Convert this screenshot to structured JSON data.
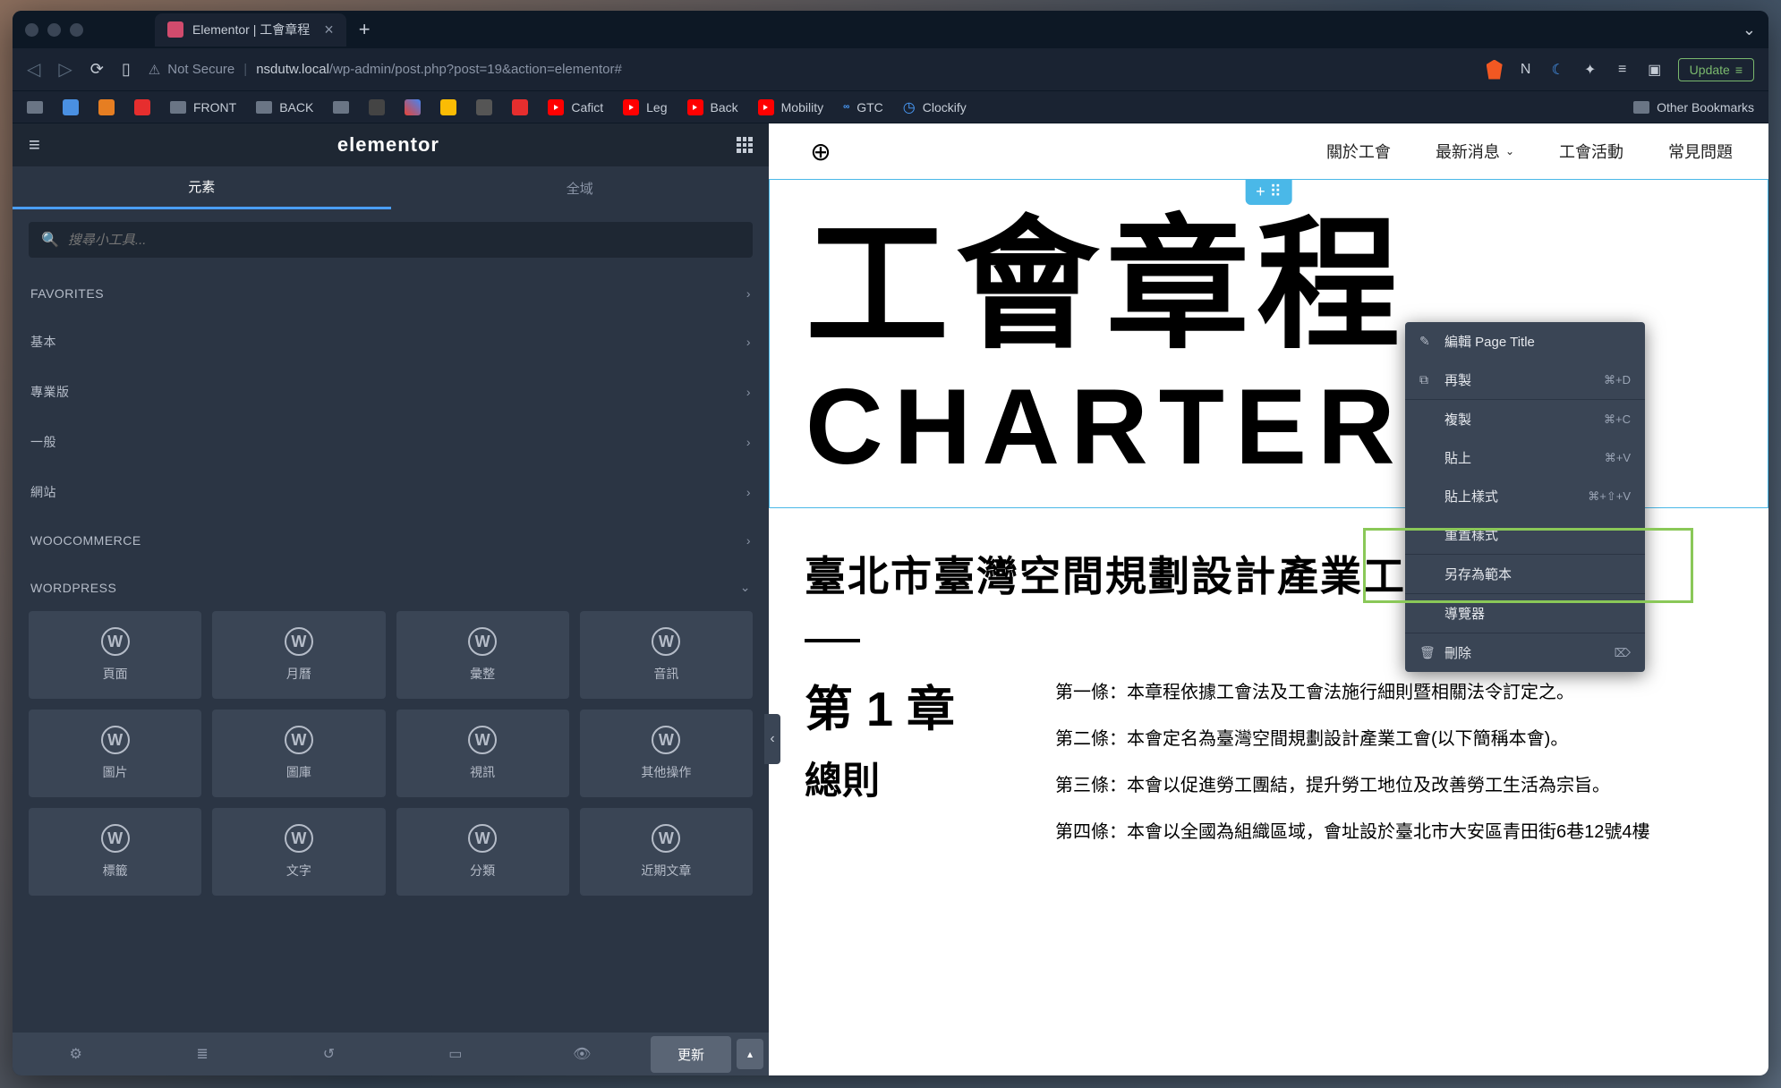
{
  "browser": {
    "tab_title": "Elementor | 工會章程",
    "not_secure": "Not Secure",
    "url_domain": "nsdutw.local",
    "url_path": "/wp-admin/post.php?post=19&action=elementor#",
    "update_button": "Update"
  },
  "bookmarks": {
    "front": "FRONT",
    "back": "BACK",
    "cafict": "Cafict",
    "leg": "Leg",
    "back2": "Back",
    "mobility": "Mobility",
    "gtc": "GTC",
    "clockify": "Clockify",
    "other": "Other Bookmarks"
  },
  "elementor": {
    "logo": "elementor",
    "tab_elements": "元素",
    "tab_global": "全域",
    "search_placeholder": "搜尋小工具...",
    "update_btn": "更新",
    "categories": {
      "favorites": "FAVORITES",
      "basic": "基本",
      "pro": "專業版",
      "general": "一般",
      "site": "網站",
      "woocommerce": "WOOCOMMERCE",
      "wordpress": "WORDPRESS"
    },
    "widgets": [
      "頁面",
      "月曆",
      "彙整",
      "音訊",
      "圖片",
      "圖庫",
      "視訊",
      "其他操作",
      "標籤",
      "文字",
      "分類",
      "近期文章"
    ]
  },
  "page": {
    "nav": {
      "about": "關於工會",
      "news": "最新消息",
      "events": "工會活動",
      "faq": "常見問題"
    },
    "title_zh": "工會章程",
    "title_en": "CHARTER",
    "org_title": "臺北市臺灣空間規劃設計產業工會",
    "chapter_num": "第 1 章",
    "chapter_name": "總則",
    "article1": "第一條：本章程依據工會法及工會法施行細則暨相關法令訂定之。",
    "article2": "第二條：本會定名為臺灣空間規劃設計產業工會(以下簡稱本會)。",
    "article3": "第三條：本會以促進勞工團結，提升勞工地位及改善勞工生活為宗旨。",
    "article4": "第四條：本會以全國為組織區域，會址設於臺北市大安區青田街6巷12號4樓"
  },
  "context_menu": {
    "edit": "編輯 Page Title",
    "duplicate": "再製",
    "duplicate_key": "⌘+D",
    "copy": "複製",
    "copy_key": "⌘+C",
    "paste": "貼上",
    "paste_key": "⌘+V",
    "paste_style": "貼上樣式",
    "paste_style_key": "⌘+⇧+V",
    "reset_style": "重置樣式",
    "save_template": "另存為範本",
    "navigator": "導覽器",
    "delete": "刪除",
    "delete_key": "⌦"
  }
}
